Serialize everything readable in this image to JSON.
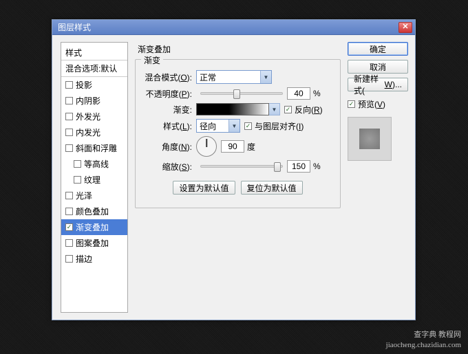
{
  "dialog": {
    "title": "图层样式"
  },
  "stylesList": {
    "header": "样式",
    "blendHeader": "混合选项:默认",
    "items": [
      {
        "label": "投影",
        "checked": false
      },
      {
        "label": "内阴影",
        "checked": false
      },
      {
        "label": "外发光",
        "checked": false
      },
      {
        "label": "内发光",
        "checked": false
      },
      {
        "label": "斜面和浮雕",
        "checked": false
      },
      {
        "label": "等高线",
        "checked": false,
        "sub": true
      },
      {
        "label": "纹理",
        "checked": false,
        "sub": true
      },
      {
        "label": "光泽",
        "checked": false
      },
      {
        "label": "颜色叠加",
        "checked": false
      },
      {
        "label": "渐变叠加",
        "checked": true,
        "selected": true
      },
      {
        "label": "图案叠加",
        "checked": false
      },
      {
        "label": "描边",
        "checked": false
      }
    ]
  },
  "panel": {
    "title": "渐变叠加",
    "group": "渐变",
    "blendModeLabel_pre": "混合模式(",
    "blendModeLabel_u": "O",
    "blendModeLabel_post": "):",
    "blendModeValue": "正常",
    "opacityLabel_pre": "不透明度(",
    "opacityLabel_u": "P",
    "opacityLabel_post": "):",
    "opacityValue": "40",
    "gradientLabel": "渐变:",
    "reverse_pre": "反向(",
    "reverse_u": "R",
    "reverse_post": ")",
    "reverseChecked": true,
    "styleLabel_pre": "样式(",
    "styleLabel_u": "L",
    "styleLabel_post": "):",
    "styleValue": "径向",
    "align_pre": "与图层对齐(",
    "align_u": "I",
    "align_post": ")",
    "alignChecked": true,
    "angleLabel_pre": "角度(",
    "angleLabel_u": "N",
    "angleLabel_post": "):",
    "angleValue": "90",
    "angleUnit": "度",
    "scaleLabel_pre": "缩放(",
    "scaleLabel_u": "S",
    "scaleLabel_post": "):",
    "scaleValue": "150",
    "percent": "%",
    "resetDefault": "设置为默认值",
    "restoreDefault": "复位为默认值"
  },
  "actions": {
    "ok": "确定",
    "cancel": "取消",
    "newStyle_pre": "新建样式(",
    "newStyle_u": "W",
    "newStyle_post": ")...",
    "preview_pre": "预览(",
    "preview_u": "V",
    "preview_post": ")",
    "previewChecked": true
  },
  "watermark": {
    "line1": "查字典 教程网",
    "line2": "jiaocheng.chazidian.com"
  }
}
